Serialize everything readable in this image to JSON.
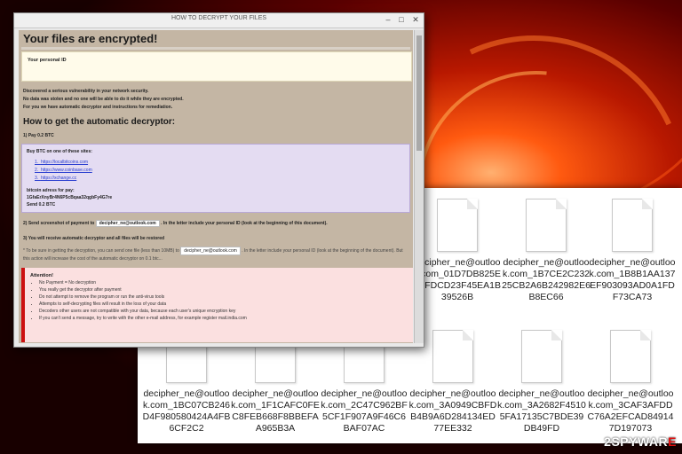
{
  "window": {
    "title": "HOW TO DECRYPT YOUR FILES",
    "heading": "Your files are encrypted!",
    "personal_id_label": "Your personal ID",
    "intro": [
      "Discovered a serious vulnerability in your network security.",
      "No data was stolen and no one will be able to do it while they are encrypted.",
      "For you we have automatic decryptor and instructions for remediation."
    ],
    "how_heading": "How to get the automatic decryptor:",
    "step1": "1) Pay 0.2 BTC",
    "buy_label": "Buy BTC on one of these sites:",
    "sites": [
      "https://localbitcoins.com",
      "https://www.coinbase.com",
      "https://xchange.cc"
    ],
    "bitcoin_label": "bitcoin adress for pay:",
    "bitcoin_address": "1GfaErXnyBr4N6P5cBqaa32qgbFy4G7re",
    "send": "Send 0.2 BTC",
    "step2_pre": "2) Send screenshot of payment to",
    "email": "decipher_ne@outlook.com",
    "step2_post": ". In the letter include your personal ID (look at the beginning of this document).",
    "step3": "3) You will receive automatic decryptor and all files will be restored",
    "note_pre": "* To be sure in getting the decryption, you can send one file (less than 10MB) to",
    "note_post": ". In the letter include your personal ID (look at the beginning of the document). But this action will increase the cost of the automatic decryptor on 0.1 btc...",
    "attention_title": "Attention!",
    "attention_items": [
      "No Payment = No decryption",
      "You really get the decryptor after payment",
      "Do not attempt to remove the program or run the anti-virus tools",
      "Attempts to self-decrypting files will result in the loss of your data",
      "Decoders other users are not compatible with your data, because each user's unique encryption key",
      "If you can't send a message, try to write with the other e-mail address, for example register mail.india.com"
    ]
  },
  "files": [
    {
      "name": "decipher_ne@outlook.com_01D7DB825EF8FDCD23F45EA1B39526B"
    },
    {
      "name": "decipher_ne@outlook.com_1B7CE2C23225CB2A6B242982E6B8EC66"
    },
    {
      "name": "decipher_ne@outlook.com_1B8B1AA137EF903093AD0A1FDF73CA73"
    },
    {
      "name": "decipher_ne@outlook.com_1BC07CB246D4F980580424A4FB6CF2C2"
    },
    {
      "name": "decipher_ne@outlook.com_1F1CAFC0FEC8FEB668F8BBEFAA965B3A"
    },
    {
      "name": "decipher_ne@outlook.com_2C47C962BF5CF1F907A9F46C6BAF07AC"
    },
    {
      "name": "decipher_ne@outlook.com_3A0949CBFDB4B9A6D284134ED77EE332"
    },
    {
      "name": "decipher_ne@outlook.com_3A2682F45105FA17135C7BDE39DB49FD"
    },
    {
      "name": "decipher_ne@outlook.com_3CAF3AFDDC76A2EFCAD849147D197073"
    }
  ],
  "watermark": {
    "part1": "2",
    "part2": "SPYWAR",
    "part3": "E"
  }
}
